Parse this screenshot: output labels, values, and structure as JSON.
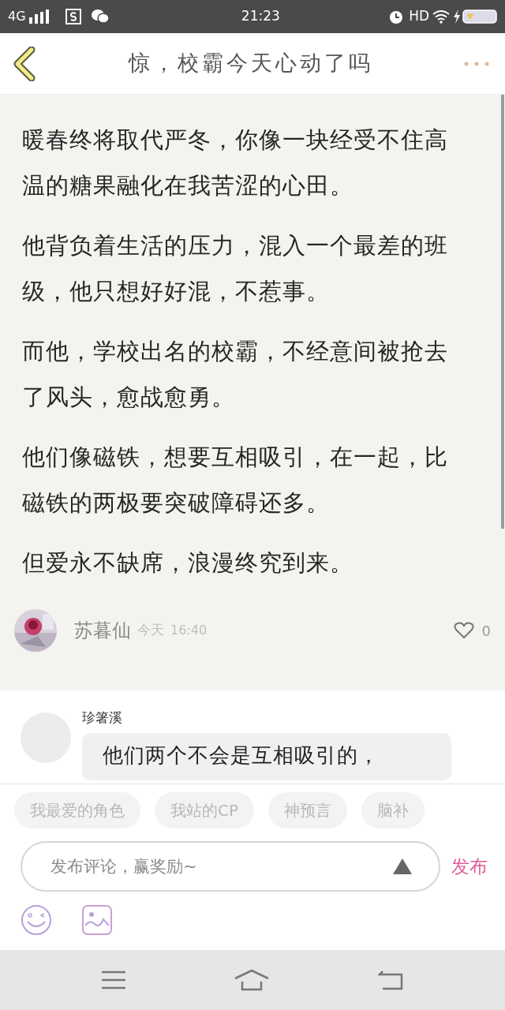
{
  "status_bar": {
    "network": "4G",
    "time": "21:23",
    "hd": "HD"
  },
  "header": {
    "title": "惊，校霸今天心动了吗"
  },
  "post": {
    "paragraphs": [
      "暖春终将取代严冬，你像一块经受不住高温的糖果融化在我苦涩的心田。",
      "他背负着生活的压力，混入一个最差的班级，他只想好好混，不惹事。",
      "而他，学校出名的校霸，不经意间被抢去了风头，愈战愈勇。",
      "他们像磁铁，想要互相吸引，在一起，比磁铁的两极要突破障碍还多。",
      "但爱永不缺席，浪漫终究到来。"
    ],
    "author": "苏暮仙",
    "date": "今天",
    "time": "16:40",
    "likes": "0"
  },
  "comment": {
    "name": "珍箸溪",
    "text": "他们两个不会是互相吸引的，"
  },
  "chips": [
    "我最爱的角色",
    "我站的CP",
    "神预言",
    "脑补"
  ],
  "composer": {
    "placeholder": "发布评论，赢奖励~",
    "send": "发布"
  }
}
